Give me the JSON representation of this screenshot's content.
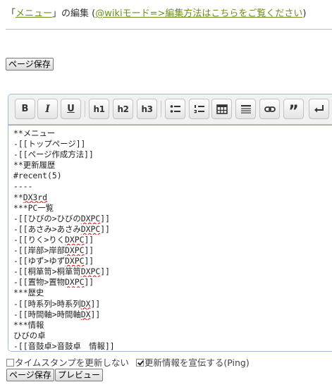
{
  "header": {
    "prefix": "「",
    "page_name": "メニュー",
    "suffix": "」の編集 (",
    "help_link": "@wikiモード=>編集方法はこちらをご覧ください",
    "close_paren": ")"
  },
  "buttons": {
    "save_top": "ページ保存",
    "save_bottom": "ページ保存",
    "preview": "プレビュー"
  },
  "toolbar": {
    "bold": "B",
    "italic": "I",
    "underline": "U",
    "h1": "h1",
    "h2": "h2",
    "h3": "h3",
    "bullet_list_icon": "bullet-list",
    "numbered_list_icon": "numbered-list",
    "table_icon": "table",
    "hr_icon": "horizontal-rule",
    "link_icon": "link",
    "quote": "”",
    "newline_icon": "line-break"
  },
  "editor": {
    "lines": [
      "**メニュー",
      "-[[トップページ]]",
      "-[[ページ作成方法]]",
      "**更新履歴",
      "#recent(5)",
      "----",
      "**DX3rd",
      "***PC一覧",
      "-[[ひびの>ひびのDXPC]]",
      "-[[あさみ>あさみDXPC]]",
      "-[[りく>りくDXPC]]",
      "-[[岸部>岸部DXPC]]",
      "-[[ゆず>ゆずDXPC]]",
      "-[[桐箪笥>桐箪笥DXPC]]",
      "-[[置物>置物DXPC]]",
      "***歴史",
      "-[[時系列>時系列DX]]",
      "-[[時間軸>時間軸DX]]",
      "***情報",
      "ひびの卓",
      "-[[音鼓卓>音鼓卓　情報]]"
    ]
  },
  "options": {
    "timestamp_label": "タイムスタンプを更新しない",
    "timestamp_checked": false,
    "ping_label": "更新情報を宣伝する(Ping)",
    "ping_checked": true
  },
  "colors": {
    "link": "#6a8f1a",
    "editor_border": "#9fbcd8",
    "spellcheck": "#e00000"
  }
}
